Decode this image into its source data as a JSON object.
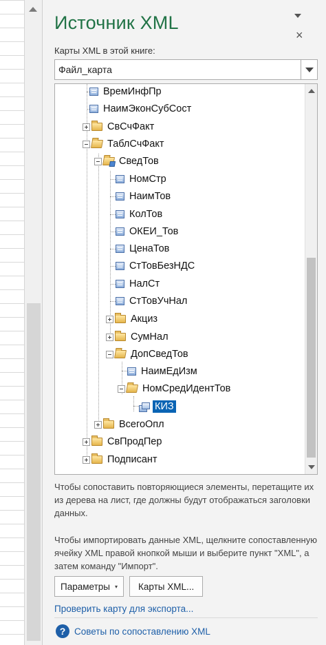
{
  "pane": {
    "title": "Источник XML",
    "maps_label": "Карты XML в этой книге:",
    "selected_map": "Файл_карта"
  },
  "tree": {
    "rows": [
      {
        "label": "ВремИнфПр",
        "type": "element"
      },
      {
        "label": "НаимЭконСубСост",
        "type": "element"
      },
      {
        "label": "СвСчФакт",
        "type": "folder",
        "expanded": false
      },
      {
        "label": "ТаблСчФакт",
        "type": "folder",
        "expanded": true
      },
      {
        "label": "СведТов",
        "type": "repeating-folder",
        "expanded": true
      },
      {
        "label": "НомСтр",
        "type": "element"
      },
      {
        "label": "НаимТов",
        "type": "element"
      },
      {
        "label": "КолТов",
        "type": "element"
      },
      {
        "label": "ОКЕИ_Тов",
        "type": "element"
      },
      {
        "label": "ЦенаТов",
        "type": "element"
      },
      {
        "label": "СтТовБезНДС",
        "type": "element"
      },
      {
        "label": "НалСт",
        "type": "element"
      },
      {
        "label": "СтТовУчНал",
        "type": "element"
      },
      {
        "label": "Акциз",
        "type": "folder",
        "expanded": false
      },
      {
        "label": "СумНал",
        "type": "folder",
        "expanded": false
      },
      {
        "label": "ДопСведТов",
        "type": "folder",
        "expanded": true
      },
      {
        "label": "НаимЕдИзм",
        "type": "element"
      },
      {
        "label": "НомСредИдентТов",
        "type": "folder",
        "expanded": true
      },
      {
        "label": "КИЗ",
        "type": "repeating-element",
        "selected": true
      },
      {
        "label": "ВсегоОпл",
        "type": "folder",
        "expanded": false
      },
      {
        "label": "СвПродПер",
        "type": "folder",
        "expanded": false
      },
      {
        "label": "Подписант",
        "type": "folder",
        "expanded": false
      }
    ]
  },
  "help": {
    "repeat_text": "Чтобы сопоставить повторяющиеся элементы, перетащите их из дерева на лист, где должны будут отображаться заголовки данных.",
    "import_text": "Чтобы импортировать данные XML, щелкните сопоставленную ячейку XML правой кнопкой мыши и выберите пункт \"XML\", а затем команду \"Импорт\"."
  },
  "buttons": {
    "options": "Параметры",
    "maps": "Карты XML..."
  },
  "links": {
    "verify": "Проверить карту для экспорта...",
    "tips": "Советы по сопоставлению XML"
  },
  "icons": {
    "close": "×",
    "help": "?",
    "caret": "▾"
  },
  "colors": {
    "title_green": "#217346",
    "selection_blue": "#0a64b4",
    "link_blue": "#1e5fa8"
  }
}
